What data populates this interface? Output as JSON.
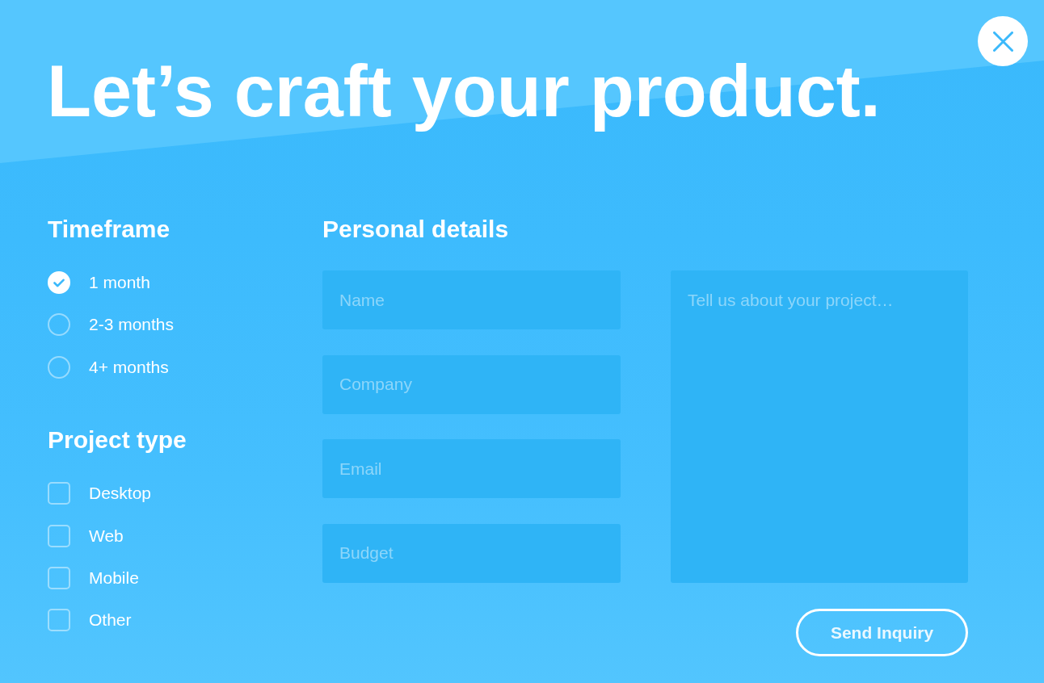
{
  "title": "Let’s craft your product.",
  "timeframe": {
    "heading": "Timeframe",
    "options": [
      {
        "label": "1 month",
        "selected": true
      },
      {
        "label": "2-3 months",
        "selected": false
      },
      {
        "label": "4+ months",
        "selected": false
      }
    ]
  },
  "project_type": {
    "heading": "Project type",
    "options": [
      {
        "label": "Desktop",
        "checked": false
      },
      {
        "label": "Web",
        "checked": false
      },
      {
        "label": "Mobile",
        "checked": false
      },
      {
        "label": "Other",
        "checked": false
      }
    ]
  },
  "personal_details": {
    "heading": "Personal details",
    "fields": [
      {
        "placeholder": "Name"
      },
      {
        "placeholder": "Company"
      },
      {
        "placeholder": "Email"
      },
      {
        "placeholder": "Budget"
      }
    ]
  },
  "message": {
    "placeholder": "Tell us about your project…"
  },
  "send_button": {
    "label": "Send Inquiry"
  }
}
